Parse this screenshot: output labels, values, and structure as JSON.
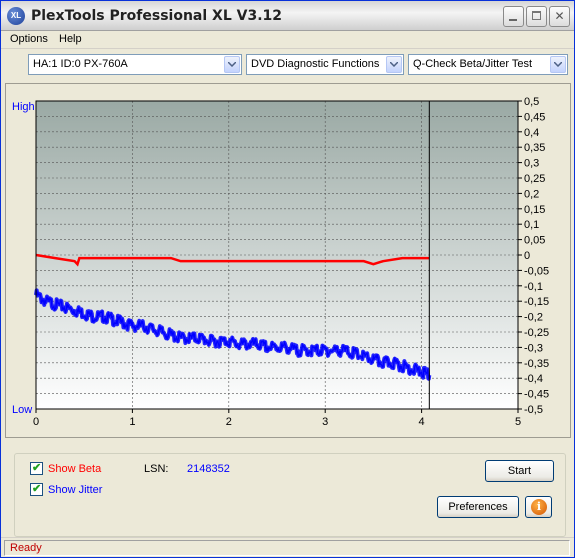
{
  "window": {
    "title": "PlexTools Professional XL V3.12",
    "app_icon_text": "XL"
  },
  "menu": {
    "items": [
      {
        "label": "Options"
      },
      {
        "label": "Help"
      }
    ]
  },
  "toolbar": {
    "drive_select": "HA:1 ID:0  PX-760A",
    "function_select": "DVD Diagnostic Functions",
    "test_select": "Q-Check Beta/Jitter Test"
  },
  "chart": {
    "left_axis_top": "High",
    "left_axis_bottom": "Low",
    "x_ticks": [
      "0",
      "1",
      "2",
      "3",
      "4",
      "5"
    ],
    "right_ticks": [
      "0,5",
      "0,45",
      "0,4",
      "0,35",
      "0,3",
      "0,25",
      "0,2",
      "0,15",
      "0,1",
      "0,05",
      "0",
      "-0,05",
      "-0,1",
      "-0,15",
      "-0,2",
      "-0,25",
      "-0,3",
      "-0,35",
      "-0,4",
      "-0,45",
      "-0,5"
    ],
    "colors": {
      "beta": "#ff0000",
      "jitter": "#0000ff",
      "plot_top": "#9aa9a4",
      "plot_bottom": "#ffffff",
      "axis_label": "#0000ff"
    }
  },
  "chart_data": {
    "type": "line",
    "xlim": [
      0,
      5
    ],
    "ylim": [
      -0.5,
      0.5
    ],
    "grid": true,
    "end_marker_x": 4.08,
    "series": [
      {
        "name": "Beta",
        "color": "#ff0000",
        "x": [
          0.0,
          0.2,
          0.4,
          0.43,
          0.45,
          0.6,
          0.8,
          1.0,
          1.2,
          1.4,
          1.5,
          1.6,
          1.8,
          2.0,
          2.2,
          2.4,
          2.6,
          2.8,
          3.0,
          3.2,
          3.4,
          3.5,
          3.6,
          3.8,
          4.0,
          4.08
        ],
        "y": [
          0.0,
          -0.01,
          -0.02,
          -0.03,
          -0.01,
          -0.01,
          -0.01,
          -0.01,
          -0.01,
          -0.01,
          -0.02,
          -0.02,
          -0.02,
          -0.02,
          -0.02,
          -0.02,
          -0.02,
          -0.02,
          -0.02,
          -0.02,
          -0.02,
          -0.03,
          -0.02,
          -0.01,
          -0.01,
          -0.01
        ]
      },
      {
        "name": "Jitter",
        "color": "#0000ff",
        "x": [
          0.0,
          0.1,
          0.2,
          0.3,
          0.4,
          0.5,
          0.6,
          0.7,
          0.8,
          0.9,
          1.0,
          1.1,
          1.2,
          1.3,
          1.4,
          1.5,
          1.6,
          1.7,
          1.8,
          1.9,
          2.0,
          2.1,
          2.2,
          2.3,
          2.4,
          2.5,
          2.6,
          2.7,
          2.8,
          2.9,
          3.0,
          3.1,
          3.2,
          3.3,
          3.4,
          3.5,
          3.6,
          3.7,
          3.8,
          3.9,
          4.0,
          4.08
        ],
        "y": [
          -0.13,
          -0.15,
          -0.16,
          -0.17,
          -0.18,
          -0.19,
          -0.2,
          -0.2,
          -0.21,
          -0.22,
          -0.23,
          -0.23,
          -0.24,
          -0.25,
          -0.26,
          -0.27,
          -0.27,
          -0.27,
          -0.28,
          -0.28,
          -0.28,
          -0.29,
          -0.29,
          -0.29,
          -0.3,
          -0.3,
          -0.3,
          -0.31,
          -0.31,
          -0.31,
          -0.31,
          -0.31,
          -0.31,
          -0.32,
          -0.33,
          -0.34,
          -0.35,
          -0.35,
          -0.36,
          -0.37,
          -0.38,
          -0.39
        ]
      }
    ]
  },
  "controls": {
    "show_beta_label": "Show Beta",
    "show_jitter_label": "Show Jitter",
    "lsn_label": "LSN:",
    "lsn_value": "2148352",
    "start_button": "Start",
    "preferences_button": "Preferences",
    "beta_checked": true,
    "jitter_checked": true
  },
  "status": {
    "text": "Ready"
  }
}
